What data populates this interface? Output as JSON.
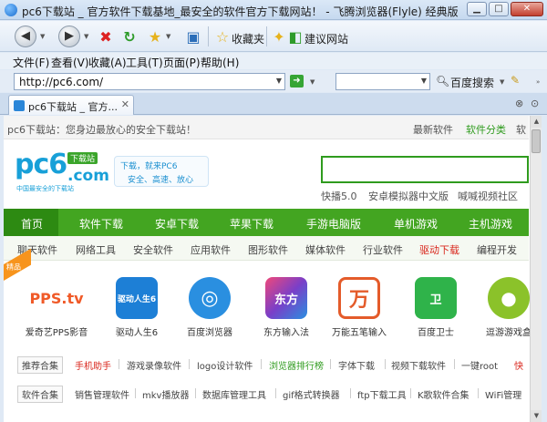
{
  "window": {
    "title": "pc6下载站 _ 官方软件下载基地_最安全的软件官方下载网站！ - 飞腾浏览器(Flyle) 经典版"
  },
  "toolbar": {
    "favorites_label": "收藏夹",
    "suggest_label": "建议网站"
  },
  "menubar": [
    "文件(F)",
    "查看(V)",
    "收藏(A)",
    "工具(T)",
    "页面(P)",
    "帮助(H)"
  ],
  "address": {
    "url": "http://pc6.com/"
  },
  "search_engine": {
    "label": "百度搜索"
  },
  "tabs": [
    {
      "title": "pc6下载站 _ 官方..."
    }
  ],
  "page": {
    "topbar": {
      "welcome": "pc6下载站：您身边最放心的安全下载站！",
      "links": [
        "最新软件",
        "软件分类",
        "软"
      ]
    },
    "logo": {
      "pc6": "pc6",
      "com": ".com",
      "tag": "下载站",
      "sub": "中国最安全的下载站"
    },
    "slogan": {
      "line1": "下载，就来PC6",
      "line2": "安全、高速、放心"
    },
    "hot_links": [
      "快播5.0",
      "安卓模拟器中文版",
      "喊喊视频社区"
    ],
    "main_nav": [
      "首页",
      "软件下载",
      "安卓下载",
      "苹果下载",
      "手游电脑版",
      "单机游戏",
      "主机游戏"
    ],
    "sub_nav": [
      "聊天软件",
      "网络工具",
      "安全软件",
      "应用软件",
      "图形软件",
      "媒体软件",
      "行业软件",
      "驱动下载",
      "编程开发"
    ],
    "ribbon": "精品",
    "apps": [
      {
        "name": "爱奇艺PPS影音",
        "badge": "PPS.tv",
        "color": "#f05a28"
      },
      {
        "name": "驱动人生6",
        "badge": "驱动人生6",
        "color": "#1d7fd6"
      },
      {
        "name": "百度浏览器",
        "badge": "◎",
        "color": "#2a8fe0"
      },
      {
        "name": "东方输入法",
        "badge": "东方",
        "color": "#7a3fc8"
      },
      {
        "name": "万能五笔输入",
        "badge": "万",
        "color": "#e45b2a"
      },
      {
        "name": "百度卫士",
        "badge": "卫",
        "color": "#2fb34a"
      },
      {
        "name": "逗游游戏盒",
        "badge": "●",
        "color": "#8bc22a"
      }
    ],
    "recommend": {
      "head": "推荐合集",
      "tags": [
        "手机助手",
        "游戏录像软件",
        "logo设计软件",
        "浏览器排行榜",
        "字体下载",
        "视频下载软件",
        "一键root",
        "快"
      ]
    },
    "collections": {
      "head": "软件合集",
      "tags": [
        "销售管理软件",
        "mkv播放器",
        "数据库管理工具",
        "gif格式转换器",
        "ftp下载工具",
        "K歌软件合集",
        "WiFi管理"
      ]
    }
  },
  "colors": {
    "nav_green": "#43a521",
    "brand_blue": "#18a0d8",
    "accent_red": "#d9261c"
  }
}
